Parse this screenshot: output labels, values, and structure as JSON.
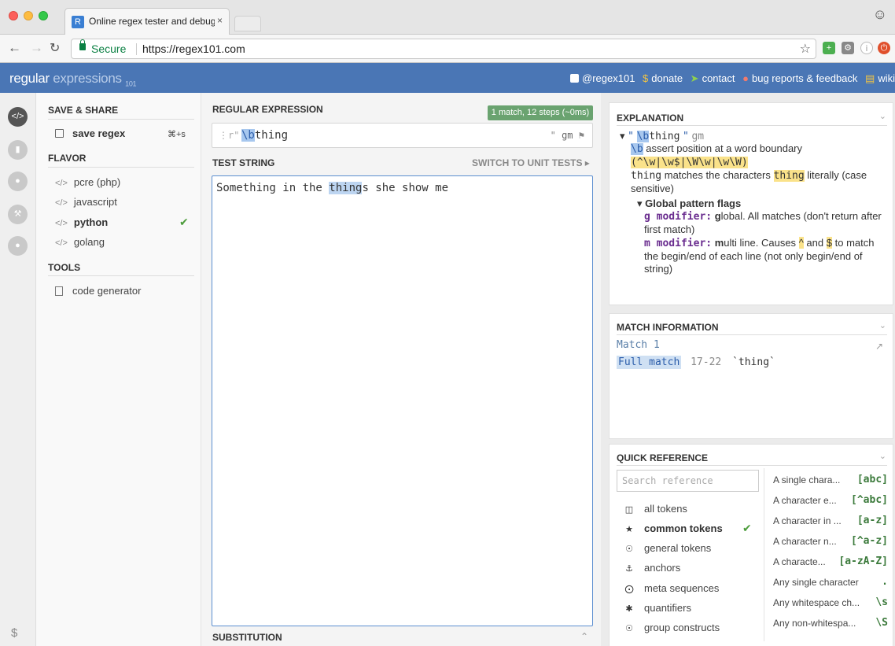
{
  "browser": {
    "tab_title": "Online regex tester and debugger",
    "tab_close": "×",
    "favicon": "R",
    "secure_label": "Secure",
    "url": "https://regex101.com"
  },
  "site": {
    "logo_main": "regular",
    "logo_sub": "expressions",
    "logo_ver": "101",
    "links": {
      "twitter": "@regex101",
      "donate": "donate",
      "contact": "contact",
      "bugs": "bug reports & feedback",
      "wiki": "wiki"
    }
  },
  "sidebar": {
    "dollar": "$",
    "save_share": {
      "heading": "SAVE & SHARE",
      "save_label": "save regex",
      "save_shortcut": "⌘+s"
    },
    "flavor": {
      "heading": "FLAVOR",
      "items": [
        {
          "label": "pcre (php)"
        },
        {
          "label": "javascript"
        },
        {
          "label": "python",
          "selected": true
        },
        {
          "label": "golang"
        }
      ],
      "code_glyph": "</>"
    },
    "tools": {
      "heading": "TOOLS",
      "items": [
        {
          "label": "code generator"
        }
      ]
    }
  },
  "regex": {
    "heading": "REGULAR EXPRESSION",
    "status": "1 match, 12 steps (~0ms)",
    "prefix": "r\"",
    "pattern_token": "\\b",
    "pattern_rest": "thing",
    "suffix": "\"",
    "flags": "gm"
  },
  "test": {
    "heading": "TEST STRING",
    "switch_label": "SWITCH TO UNIT TESTS ▸",
    "before": "Something in the ",
    "match": "thing",
    "after": "s she show me"
  },
  "substitution": {
    "heading": "SUBSTITUTION"
  },
  "explanation": {
    "heading": "EXPLANATION",
    "summary_open": "\"",
    "summary_token": "\\b",
    "summary_rest": "thing",
    "summary_close": "\"",
    "summary_flags": "gm",
    "line1_tok": "\\b",
    "line1_text": "assert position at a word boundary",
    "line1_equiv": "(^\\w|\\w$|\\W\\w|\\w\\W)",
    "line2_tok": "thing",
    "line2_text": "matches the characters",
    "line2_lit": "thing",
    "line2_end": "literally (case sensitive)",
    "flags_heading": "Global pattern flags",
    "g_mod": "g modifier:",
    "g_letter": "g",
    "g_text": "lobal. All matches (don't return after first match)",
    "m_mod": "m modifier:",
    "m_letter": "m",
    "m_text1": "ulti line. Causes",
    "m_caret": "^",
    "m_and": "and",
    "m_dollar": "$",
    "m_text2": "to match the begin/end of each line (not only begin/end of string)"
  },
  "match_info": {
    "heading": "MATCH INFORMATION",
    "match_label": "Match 1",
    "full_label": "Full match",
    "range": "17-22",
    "value": "`thing`"
  },
  "quick_ref": {
    "heading": "QUICK REFERENCE",
    "search_placeholder": "Search reference",
    "categories": [
      {
        "label": "all tokens",
        "icon": "database-icon"
      },
      {
        "label": "common tokens",
        "icon": "star-icon",
        "selected": true
      },
      {
        "label": "general tokens",
        "icon": "target-icon"
      },
      {
        "label": "anchors",
        "icon": "anchor-icon"
      },
      {
        "label": "meta sequences",
        "icon": "lifebuoy-icon"
      },
      {
        "label": "quantifiers",
        "icon": "asterisk-icon"
      },
      {
        "label": "group constructs",
        "icon": "target-icon"
      }
    ],
    "tokens": [
      {
        "desc": "A single chara...",
        "code": "[abc]"
      },
      {
        "desc": "A character e...",
        "code": "[^abc]"
      },
      {
        "desc": "A character in ...",
        "code": "[a-z]"
      },
      {
        "desc": "A character n...",
        "code": "[^a-z]"
      },
      {
        "desc": "A characte...",
        "code": "[a-zA-Z]"
      },
      {
        "desc": "Any single character",
        "code": "."
      },
      {
        "desc": "Any whitespace ch...",
        "code": "\\s"
      },
      {
        "desc": "Any non-whitespa...",
        "code": "\\S"
      }
    ]
  }
}
